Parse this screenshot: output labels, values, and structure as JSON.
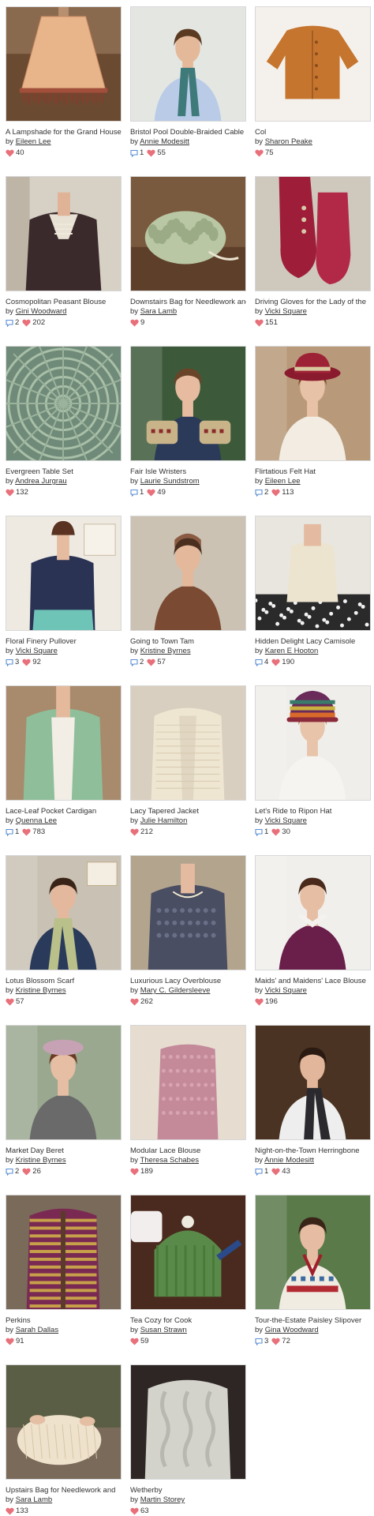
{
  "colors": {
    "heart": "#e8707a",
    "comment": "#5b8fd6",
    "link": "#333333",
    "text": "#333333"
  },
  "icons": {
    "comment": "speech-bubble-icon",
    "favorite": "heart-icon"
  },
  "patterns": [
    {
      "title": "A Lampshade for the Grand House",
      "by": "by",
      "author": "Eileen Lee",
      "comments": "",
      "favorites": "40",
      "thumb": "lampshade-thumbnail"
    },
    {
      "title": "Bristol Pool Double-Braided Cable",
      "by": "by",
      "author": "Annie Modesitt",
      "comments": "1",
      "favorites": "55",
      "thumb": "man-scarf-thumbnail"
    },
    {
      "title": "Col",
      "by": "by",
      "author": "Sharon Peake",
      "comments": "",
      "favorites": "75",
      "thumb": "orange-cardigan-thumbnail"
    },
    {
      "title": "Cosmopolitan Peasant Blouse",
      "by": "by",
      "author": "Gini Woodward",
      "comments": "2",
      "favorites": "202",
      "thumb": "peasant-blouse-thumbnail"
    },
    {
      "title": "Downstairs Bag for Needlework and",
      "by": "by",
      "author": "Sara Lamb",
      "comments": "",
      "favorites": "9",
      "thumb": "green-bag-thumbnail"
    },
    {
      "title": "Driving Gloves for the Lady of the",
      "by": "by",
      "author": "Vicki Square",
      "comments": "",
      "favorites": "151",
      "thumb": "red-gloves-thumbnail"
    },
    {
      "title": "Evergreen Table Set",
      "by": "by",
      "author": "Andrea Jurgrau",
      "comments": "",
      "favorites": "132",
      "thumb": "lace-doily-thumbnail"
    },
    {
      "title": "Fair Isle Wristers",
      "by": "by",
      "author": "Laurie Sundstrom",
      "comments": "1",
      "favorites": "49",
      "thumb": "wristers-thumbnail"
    },
    {
      "title": "Flirtatious Felt Hat",
      "by": "by",
      "author": "Eileen Lee",
      "comments": "2",
      "favorites": "113",
      "thumb": "felt-hat-thumbnail"
    },
    {
      "title": "Floral Finery Pullover",
      "by": "by",
      "author": "Vicki Square",
      "comments": "3",
      "favorites": "92",
      "thumb": "navy-pullover-thumbnail"
    },
    {
      "title": "Going to Town Tam",
      "by": "by",
      "author": "Kristine Byrnes",
      "comments": "2",
      "favorites": "57",
      "thumb": "brown-coat-thumbnail"
    },
    {
      "title": "Hidden Delight Lacy Camisole",
      "by": "by",
      "author": "Karen E Hooton",
      "comments": "4",
      "favorites": "190",
      "thumb": "lace-camisole-thumbnail"
    },
    {
      "title": "Lace-Leaf Pocket Cardigan",
      "by": "by",
      "author": "Quenna Lee",
      "comments": "1",
      "favorites": "783",
      "thumb": "green-cardigan-thumbnail"
    },
    {
      "title": "Lacy Tapered Jacket",
      "by": "by",
      "author": "Julie Hamilton",
      "comments": "",
      "favorites": "212",
      "thumb": "cream-jacket-thumbnail"
    },
    {
      "title": "Let's Ride to Ripon Hat",
      "by": "by",
      "author": "Vicki Square",
      "comments": "1",
      "favorites": "30",
      "thumb": "striped-hat-thumbnail"
    },
    {
      "title": "Lotus Blossom Scarf",
      "by": "by",
      "author": "Kristine Byrnes",
      "comments": "",
      "favorites": "57",
      "thumb": "lotus-scarf-thumbnail"
    },
    {
      "title": "Luxurious Lacy Overblouse",
      "by": "by",
      "author": "Mary C. Gildersleeve",
      "comments": "",
      "favorites": "262",
      "thumb": "grey-overblouse-thumbnail"
    },
    {
      "title": "Maids' and Maidens' Lace Blouse",
      "by": "by",
      "author": "Vicki Square",
      "comments": "",
      "favorites": "196",
      "thumb": "purple-blouse-thumbnail"
    },
    {
      "title": "Market Day Beret",
      "by": "by",
      "author": "Kristine Byrnes",
      "comments": "2",
      "favorites": "26",
      "thumb": "beret-thumbnail"
    },
    {
      "title": "Modular Lace Blouse",
      "by": "by",
      "author": "Theresa Schabes",
      "comments": "",
      "favorites": "189",
      "thumb": "pink-blouse-thumbnail"
    },
    {
      "title": "Night-on-the-Town Herringbone",
      "by": "by",
      "author": "Annie Modesitt",
      "comments": "1",
      "favorites": "43",
      "thumb": "herringbone-scarf-thumbnail"
    },
    {
      "title": "Perkins",
      "by": "by",
      "author": "Sarah Dallas",
      "comments": "",
      "favorites": "91",
      "thumb": "striped-cardigan-thumbnail"
    },
    {
      "title": "Tea Cozy for Cook",
      "by": "by",
      "author": "Susan Strawn",
      "comments": "",
      "favorites": "59",
      "thumb": "tea-cozy-thumbnail"
    },
    {
      "title": "Tour-the-Estate Paisley Slipover",
      "by": "by",
      "author": "Gina Woodward",
      "comments": "3",
      "favorites": "72",
      "thumb": "paisley-slipover-thumbnail"
    },
    {
      "title": "Upstairs Bag for Needlework and",
      "by": "by",
      "author": "Sara Lamb",
      "comments": "",
      "favorites": "133",
      "thumb": "cream-bag-thumbnail"
    },
    {
      "title": "Wetherby",
      "by": "by",
      "author": "Martin Storey",
      "comments": "",
      "favorites": "63",
      "thumb": "cable-sweater-thumbnail"
    }
  ]
}
